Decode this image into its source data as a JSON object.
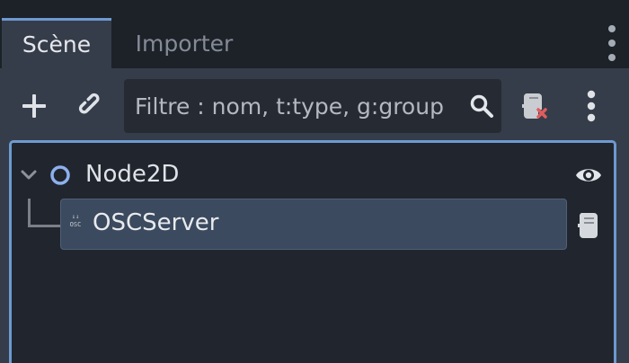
{
  "tabs": [
    {
      "label": "Scène",
      "active": true
    },
    {
      "label": "Importer",
      "active": false
    }
  ],
  "toolbar": {
    "filter_placeholder": "Filtre : nom, t:type, g:group"
  },
  "tree": {
    "root": {
      "label": "Node2D",
      "icon": "node2d-icon",
      "visible": true
    },
    "children": [
      {
        "label": "OSCServer",
        "icon_text": "OSC",
        "selected": true,
        "has_script": true
      }
    ]
  },
  "colors": {
    "accent": "#6d9ad0",
    "panel": "#363d4a",
    "tree_bg": "#21262e",
    "selection": "#3b4a5e",
    "clear_script_x": "#e05d5d"
  }
}
